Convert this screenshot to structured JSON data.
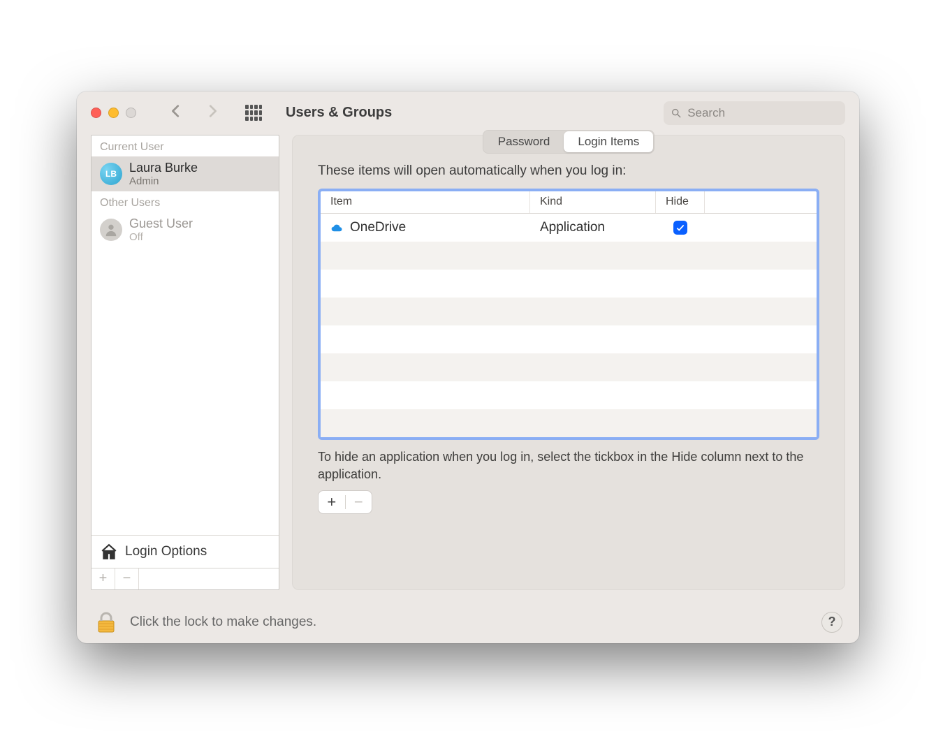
{
  "window": {
    "title": "Users & Groups"
  },
  "search": {
    "placeholder": "Search"
  },
  "sidebar": {
    "heading_current": "Current User",
    "heading_other": "Other Users",
    "current": {
      "initials": "LB",
      "name": "Laura Burke",
      "role": "Admin"
    },
    "guest": {
      "name": "Guest User",
      "role": "Off"
    },
    "login_options": "Login Options"
  },
  "tabs": {
    "password": "Password",
    "login_items": "Login Items"
  },
  "panel": {
    "description": "These items will open automatically when you log in:",
    "columns": {
      "item": "Item",
      "kind": "Kind",
      "hide": "Hide"
    },
    "rows": [
      {
        "name": "OneDrive",
        "kind": "Application",
        "hide": true
      }
    ],
    "hint": "To hide an application when you log in, select the tickbox in the Hide column next to the application."
  },
  "footer": {
    "lock_text": "Click the lock to make changes.",
    "help": "?"
  }
}
